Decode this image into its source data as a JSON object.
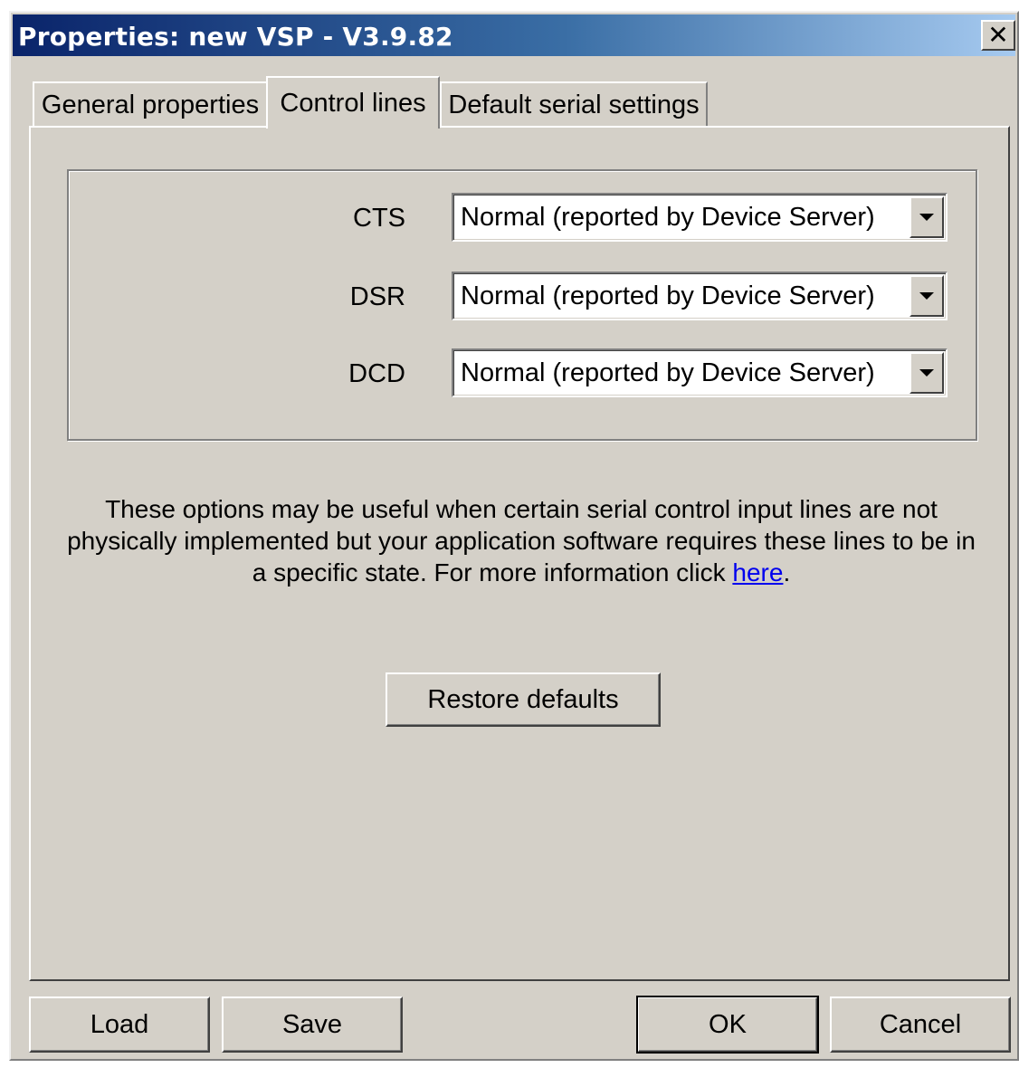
{
  "window": {
    "title": "Properties: new VSP - V3.9.82",
    "close_glyph": "✕"
  },
  "tabs": [
    {
      "label": "General properties",
      "active": false
    },
    {
      "label": "Control lines",
      "active": true
    },
    {
      "label": "Default serial settings",
      "active": false
    }
  ],
  "control_lines": [
    {
      "label": "CTS",
      "value": "Normal (reported by Device Server)"
    },
    {
      "label": "DSR",
      "value": "Normal (reported by Device Server)"
    },
    {
      "label": "DCD",
      "value": "Normal (reported by Device Server)"
    }
  ],
  "info": {
    "text": "These options may be useful when certain serial control input lines are not physically implemented but your application software requires these lines to be in a specific state. For more information click",
    "link": "here",
    "suffix": "."
  },
  "buttons": {
    "restore": "Restore defaults",
    "load": "Load",
    "save": "Save",
    "ok": "OK",
    "cancel": "Cancel"
  },
  "colors": {
    "face": "#d4d0c8",
    "title_start": "#0a246a",
    "title_end": "#a6caf0",
    "link": "#0000ee"
  },
  "icons": {
    "combo_arrow": "chevron-down-icon",
    "close": "close-icon"
  }
}
